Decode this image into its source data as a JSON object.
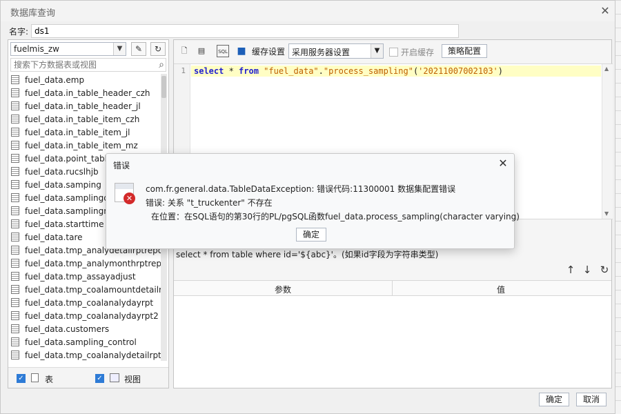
{
  "window": {
    "title": "数据库查询",
    "close_symbol": "✕"
  },
  "name_field": {
    "label": "名字:",
    "value": "ds1"
  },
  "left": {
    "db_selected": "fuelmis_zw",
    "search_placeholder": "搜索下方数据表或视图",
    "tables": [
      "fuel_data.emp",
      "fuel_data.in_table_header_czh",
      "fuel_data.in_table_header_jl",
      "fuel_data.in_table_item_czh",
      "fuel_data.in_table_item_jl",
      "fuel_data.in_table_item_mz",
      "fuel_data.point_table",
      "fuel_data.rucslhjb",
      "fuel_data.samping",
      "fuel_data.samplingdr",
      "fuel_data.samplingm",
      "fuel_data.starttime",
      "fuel_data.tare",
      "fuel_data.tmp_analydetailrptreport",
      "fuel_data.tmp_analymonthrptreport",
      "fuel_data.tmp_assayadjust",
      "fuel_data.tmp_coalamountdetailrpt",
      "fuel_data.tmp_coalanalydayrpt",
      "fuel_data.tmp_coalanalydayrpt2",
      "fuel_data.customers",
      "fuel_data.sampling_control",
      "fuel_data.tmp_coalanalydetailrpt"
    ],
    "filter_table_label": "表",
    "filter_view_label": "视图"
  },
  "toolbar": {
    "cache_label": "缓存设置",
    "cache_mode": "采用服务器设置",
    "enable_cache_label": "开启缓存",
    "strategy_button": "策略配置",
    "sql_icon_text": "SQL"
  },
  "editor": {
    "line_number": "1",
    "code": {
      "kw1": "select",
      "op1": " * ",
      "kw2": "from",
      "str1": " \"fuel_data\"",
      "op2": ".",
      "str2": "\"process_sampling\"",
      "op3": "(",
      "str3": "'20211007002103'",
      "op4": ")"
    }
  },
  "hint": "select * from table where id='${abc}'。(如果id字段为字符串类型)",
  "params": {
    "col_param": "参数",
    "col_value": "值"
  },
  "footer": {
    "ok": "确定",
    "cancel": "取消"
  },
  "error_dialog": {
    "title": "错误",
    "line1": "com.fr.general.data.TableDataException: 错误代码:11300001 数据集配置错误",
    "line2": "错误: 关系 \"t_truckenter\" 不存在",
    "line3": "在位置：在SQL语句的第30行的PL/pgSQL函数fuel_data.process_sampling(character varying)",
    "ok": "确定"
  }
}
